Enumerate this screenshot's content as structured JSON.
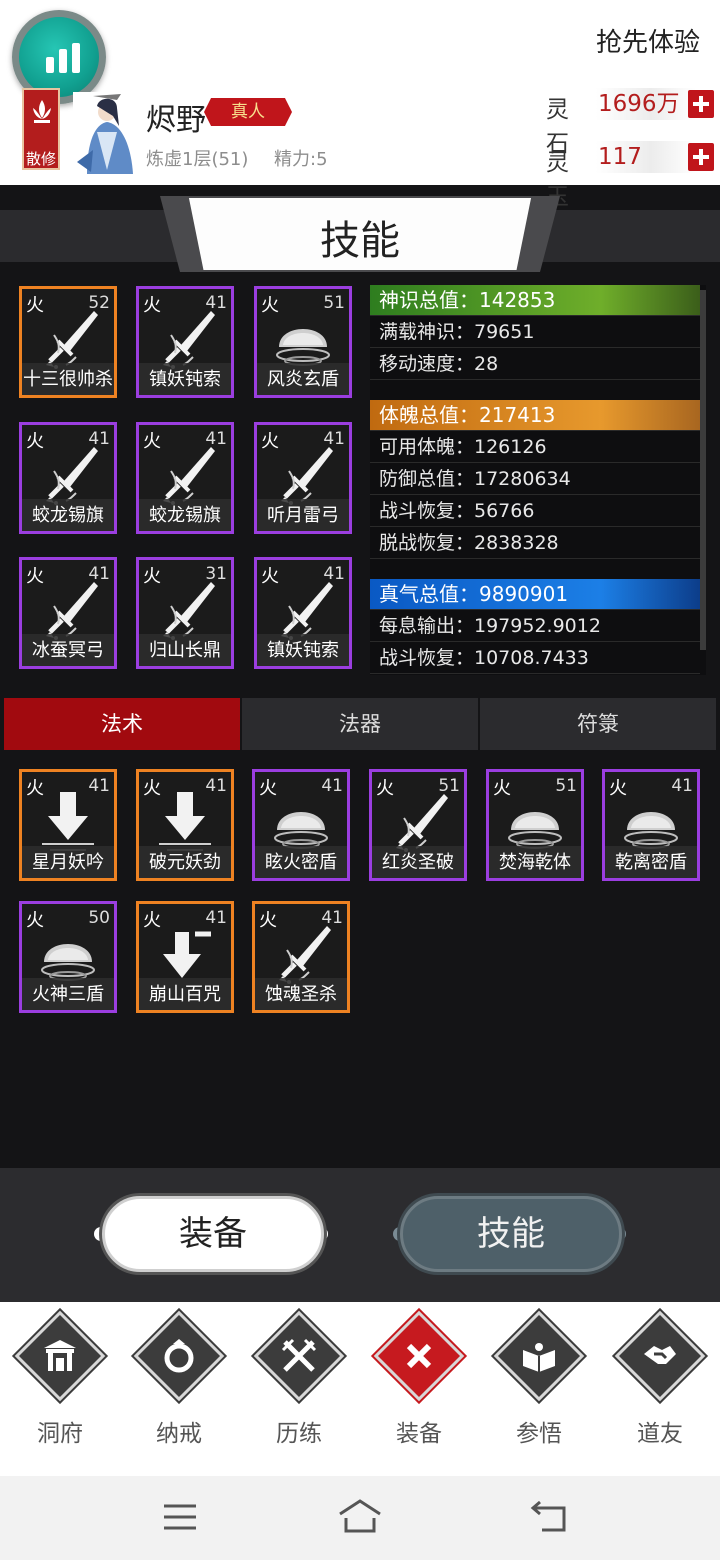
{
  "header": {
    "preview_label": "抢先体验",
    "sect_badge": "散修",
    "player_name": "烬野",
    "rank_badge": "真人",
    "realm": "炼虚1层(51)",
    "energy": "精力:5",
    "currencies": [
      {
        "label": "灵石",
        "value": "1696万"
      },
      {
        "label": "灵玉",
        "value": "117"
      }
    ]
  },
  "title": "技能",
  "equipped_skills": [
    {
      "element": "火",
      "level": "52",
      "name": "十三很帅杀",
      "icon": "sword-icon",
      "quality": "orange"
    },
    {
      "element": "火",
      "level": "41",
      "name": "镇妖钝索",
      "icon": "sword-icon",
      "quality": "purple"
    },
    {
      "element": "火",
      "level": "51",
      "name": "风炎玄盾",
      "icon": "shield-dome-icon",
      "quality": "purple"
    },
    {
      "element": "火",
      "level": "41",
      "name": "蛟龙锡旗",
      "icon": "sword-icon",
      "quality": "purple"
    },
    {
      "element": "火",
      "level": "41",
      "name": "蛟龙锡旗",
      "icon": "sword-icon",
      "quality": "purple"
    },
    {
      "element": "火",
      "level": "41",
      "name": "听月雷弓",
      "icon": "sword-icon",
      "quality": "purple"
    },
    {
      "element": "火",
      "level": "41",
      "name": "冰蚕冥弓",
      "icon": "sword-icon",
      "quality": "purple"
    },
    {
      "element": "火",
      "level": "31",
      "name": "归山长鼎",
      "icon": "sword-icon",
      "quality": "purple"
    },
    {
      "element": "火",
      "level": "41",
      "name": "镇妖钝索",
      "icon": "sword-icon",
      "quality": "purple"
    }
  ],
  "stats": {
    "groups": [
      {
        "color": "green",
        "header": "神识总值：142853",
        "rows": [
          "满载神识：79651",
          "移动速度：28"
        ]
      },
      {
        "color": "orange",
        "header": "体魄总值：217413",
        "rows": [
          "可用体魄：126126",
          "防御总值：17280634",
          "战斗恢复：56766",
          "脱战恢复：2838328"
        ]
      },
      {
        "color": "blue",
        "header": "真气总值：9890901",
        "rows": [
          "每息输出：197952.9012",
          "战斗恢复：10708.7433"
        ]
      }
    ]
  },
  "tabs": [
    {
      "label": "法术",
      "active": true
    },
    {
      "label": "法器",
      "active": false
    },
    {
      "label": "符箓",
      "active": false
    }
  ],
  "spell_skills": [
    {
      "element": "火",
      "level": "41",
      "name": "星月妖吟",
      "icon": "down-arrow-burst-icon",
      "quality": "orange"
    },
    {
      "element": "火",
      "level": "41",
      "name": "破元妖劲",
      "icon": "down-arrow-burst-icon",
      "quality": "orange"
    },
    {
      "element": "火",
      "level": "41",
      "name": "眩火密盾",
      "icon": "shield-dome-icon",
      "quality": "purple"
    },
    {
      "element": "火",
      "level": "51",
      "name": "红炎圣破",
      "icon": "sword-icon",
      "quality": "purple"
    },
    {
      "element": "火",
      "level": "51",
      "name": "焚海乾体",
      "icon": "shield-dome-icon",
      "quality": "purple"
    },
    {
      "element": "火",
      "level": "41",
      "name": "乾离密盾",
      "icon": "shield-dome-icon",
      "quality": "purple"
    },
    {
      "element": "火",
      "level": "50",
      "name": "火神三盾",
      "icon": "shield-dome-icon",
      "quality": "purple"
    },
    {
      "element": "火",
      "level": "41",
      "name": "崩山百咒",
      "icon": "down-arrow-minus-icon",
      "quality": "orange"
    },
    {
      "element": "火",
      "level": "41",
      "name": "蚀魂圣杀",
      "icon": "sword-icon",
      "quality": "orange"
    }
  ],
  "switch": {
    "equip_label": "装备",
    "skill_label": "技能"
  },
  "nav": [
    {
      "label": "洞府",
      "icon": "gate-icon",
      "active": false
    },
    {
      "label": "纳戒",
      "icon": "ring-icon",
      "active": false
    },
    {
      "label": "历练",
      "icon": "crossed-swords-icon",
      "active": false
    },
    {
      "label": "装备",
      "icon": "close-x-icon",
      "active": true
    },
    {
      "label": "参悟",
      "icon": "open-book-icon",
      "active": false
    },
    {
      "label": "道友",
      "icon": "handshake-icon",
      "active": false
    }
  ],
  "system_nav": [
    "menu-icon",
    "home-icon",
    "back-icon"
  ]
}
